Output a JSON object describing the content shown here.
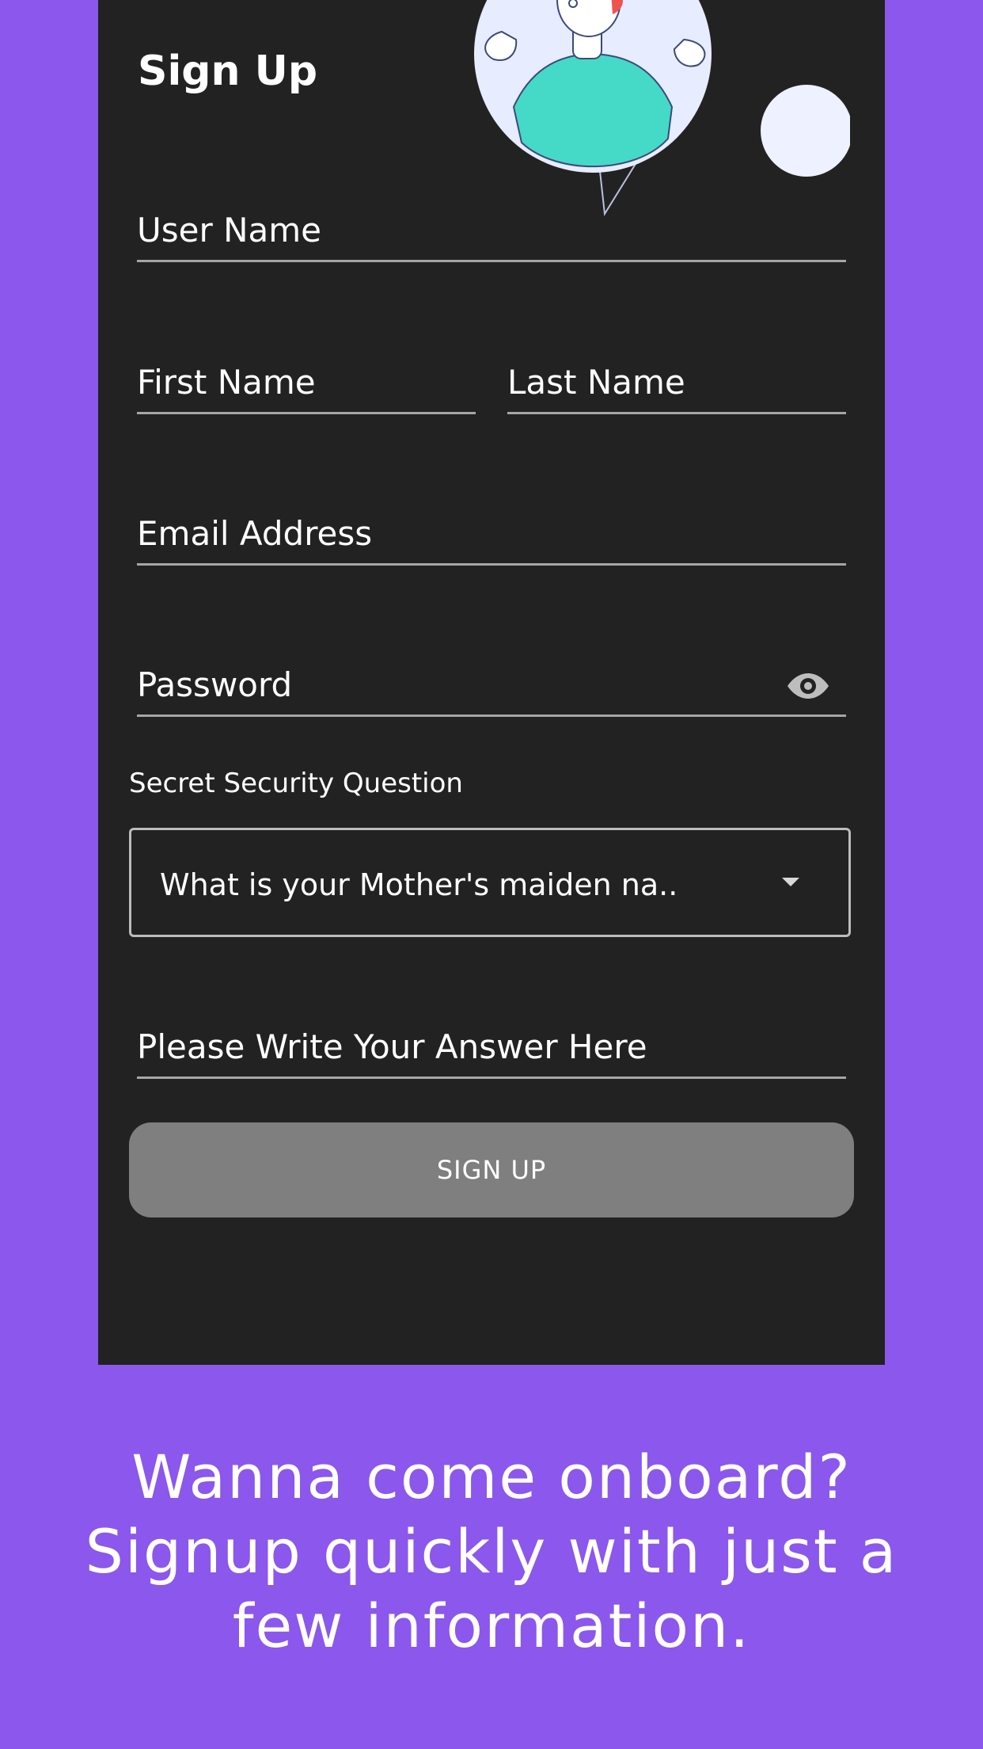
{
  "colors": {
    "background": "#8c57ec",
    "panel": "#222222",
    "button": "#7f7f7f",
    "text": "#ffffff",
    "underline": "#a6a6a6"
  },
  "form": {
    "title": "Sign Up",
    "username_placeholder": "User Name",
    "first_name_placeholder": "First Name",
    "last_name_placeholder": "Last Name",
    "email_placeholder": "Email Address",
    "password_placeholder": "Password",
    "security_label": "Secret Security Question",
    "security_question_selected": "What is your Mother's maiden na..",
    "answer_placeholder": "Please Write Your Answer Here",
    "signup_button": "SIGN UP"
  },
  "icons": {
    "password_toggle": "eye-icon",
    "dropdown": "caret-down-icon"
  },
  "tagline": "Wanna come onboard? Signup quickly with just a few information."
}
